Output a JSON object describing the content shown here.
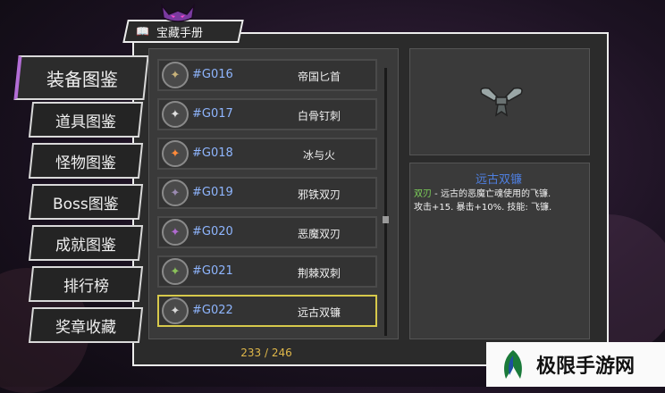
{
  "panel": {
    "title": "宝藏手册",
    "book_icon": "book-icon"
  },
  "sidebar": {
    "items": [
      {
        "label": "装备图鉴",
        "active": true
      },
      {
        "label": "道具图鉴"
      },
      {
        "label": "怪物图鉴"
      },
      {
        "label": "Boss图鉴"
      },
      {
        "label": "成就图鉴"
      },
      {
        "label": "排行榜"
      },
      {
        "label": "奖章收藏"
      }
    ]
  },
  "list": {
    "rows": [
      {
        "code": "#G016",
        "name": "帝国匕首",
        "icon": "dagger-icon",
        "color": "#c8b27a"
      },
      {
        "code": "#G017",
        "name": "白骨钉刺",
        "icon": "bone-blade-icon",
        "color": "#e0e0e0"
      },
      {
        "code": "#G018",
        "name": "冰与火",
        "icon": "fire-ice-blade-icon",
        "color": "#ff8a3a"
      },
      {
        "code": "#G019",
        "name": "邪铁双刃",
        "icon": "dual-blade-icon",
        "color": "#9a8ab0"
      },
      {
        "code": "#G020",
        "name": "恶魔双刃",
        "icon": "demon-blade-icon",
        "color": "#b06ad0"
      },
      {
        "code": "#G021",
        "name": "荆棘双刺",
        "icon": "thorn-blade-icon",
        "color": "#8ac25a"
      },
      {
        "code": "#G022",
        "name": "远古双镰",
        "icon": "scythe-icon",
        "color": "#d8d8d8",
        "selected": true
      }
    ],
    "count": "233 / 246"
  },
  "detail": {
    "title": "远古双镰",
    "type_label": "双刃",
    "line1": " - 远古的恶魔亡魂使用的飞镰.",
    "line2": "攻击+15. 暴击+10%. 技能: 飞镰."
  },
  "watermark": {
    "text": "极限手游网"
  }
}
